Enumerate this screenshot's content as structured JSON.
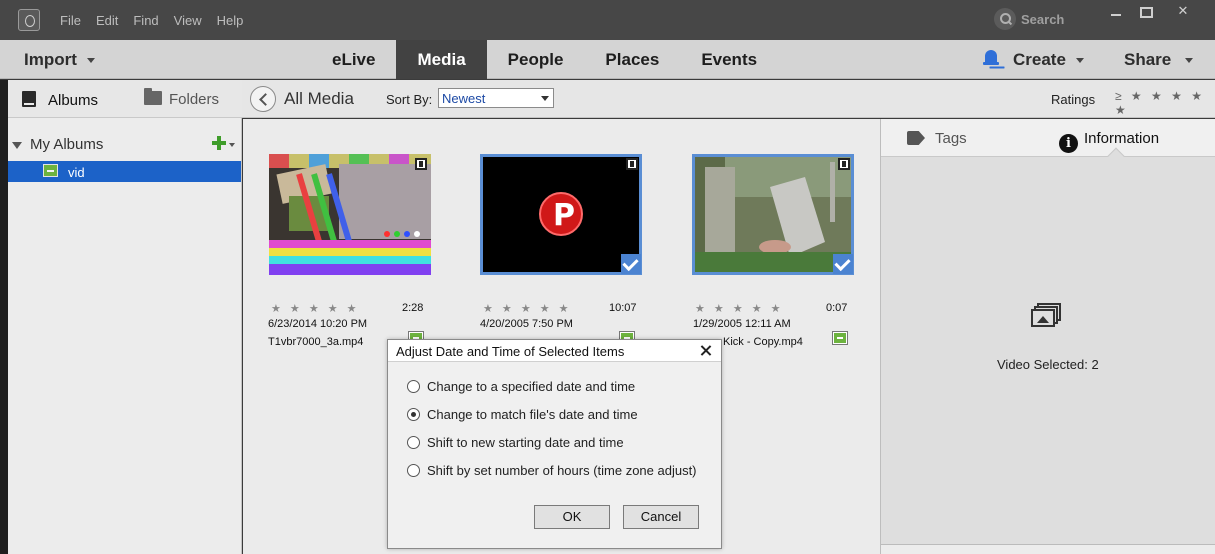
{
  "menu": [
    "File",
    "Edit",
    "Find",
    "View",
    "Help"
  ],
  "search": {
    "label": "Search"
  },
  "nav": {
    "import": "Import",
    "tabs": [
      "eLive",
      "Media",
      "People",
      "Places",
      "Events"
    ],
    "active_tab": "Media",
    "create": "Create",
    "share": "Share"
  },
  "left_panel": {
    "tab_albums": "Albums",
    "tab_folders": "Folders",
    "my_albums": "My Albums",
    "albums": [
      {
        "label": "vid"
      }
    ]
  },
  "toolbar": {
    "breadcrumb": "All Media",
    "sort_label": "Sort By:",
    "sort_value": "Newest",
    "ratings_label": "Ratings",
    "ratings_stars": "≥ ★ ★ ★ ★ ★"
  },
  "media": [
    {
      "duration": "2:28",
      "date": "6/23/2014 10:20 PM",
      "name": "T1vbr7000_3a.mp4",
      "stars": "★ ★ ★ ★ ★",
      "selected": false
    },
    {
      "duration": "10:07",
      "date": "4/20/2005 7:50 PM",
      "name": "",
      "stars": "★ ★ ★ ★ ★",
      "selected": true
    },
    {
      "duration": "0:07",
      "date": "1/29/2005 12:11 AM",
      "name": "Kick - Copy.mp4",
      "stars": "★ ★ ★ ★ ★",
      "selected": true
    }
  ],
  "right_panel": {
    "tab_tags": "Tags",
    "tab_info": "Information",
    "selected_text": "Video Selected: 2"
  },
  "dialog": {
    "title": "Adjust Date and Time of Selected Items",
    "options": [
      "Change to a specified date and time",
      "Change to match file's date and time",
      "Shift to new starting date and time",
      "Shift by set number of hours (time zone adjust)"
    ],
    "selected_option": 1,
    "ok": "OK",
    "cancel": "Cancel"
  },
  "colors": {
    "accent_blue": "#1c62c8",
    "selection_border": "#5a8ed4",
    "album_green": "#6db33f",
    "bell_blue": "#2f6fd8"
  }
}
